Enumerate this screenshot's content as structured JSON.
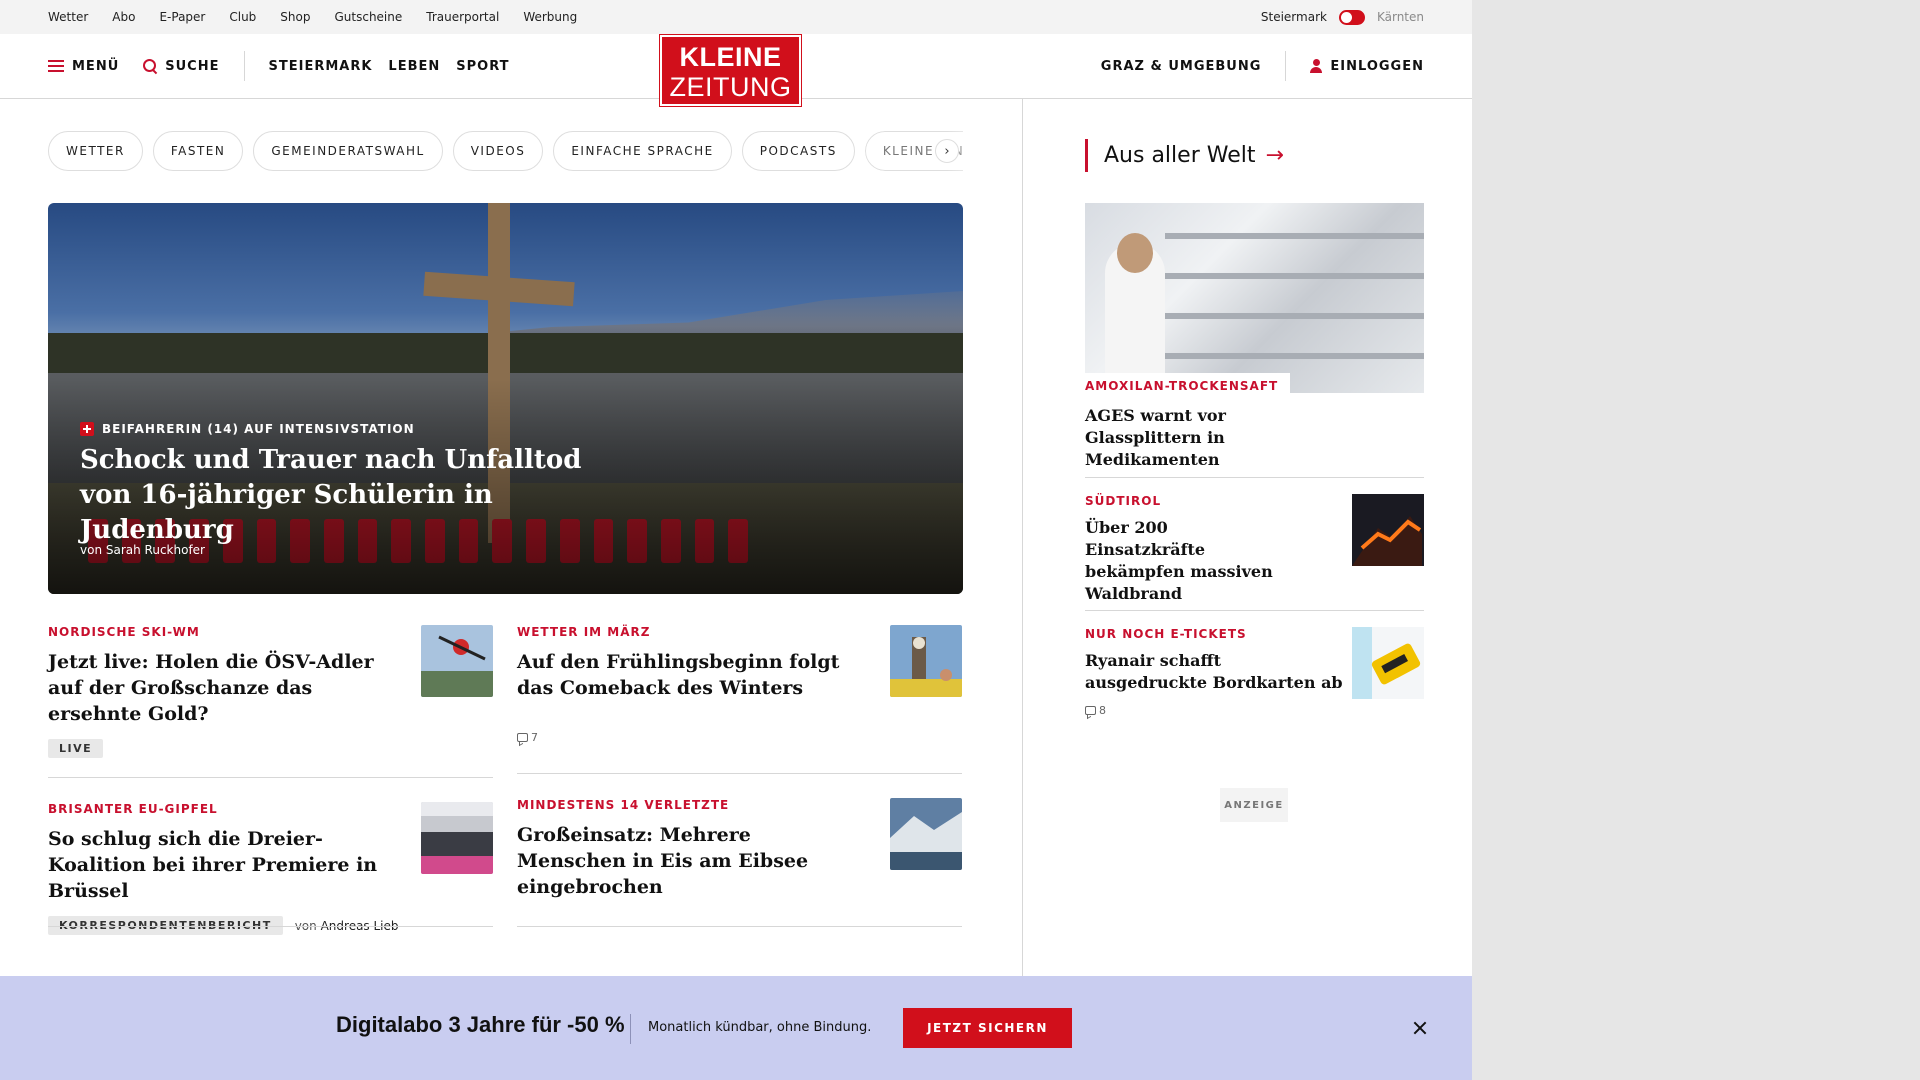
{
  "utility_bar": {
    "links": [
      "Wetter",
      "Abo",
      "E-Paper",
      "Club",
      "Shop",
      "Gutscheine",
      "Trauerportal",
      "Werbung"
    ],
    "region_active": "Steiermark",
    "region_inactive": "Kärnten"
  },
  "header": {
    "menu_label": "MENÜ",
    "search_label": "SUCHE",
    "nav": [
      "STEIERMARK",
      "LEBEN",
      "SPORT"
    ],
    "logo_line1": "KLEINE",
    "logo_line2": "ZEITUNG",
    "region_link": "GRAZ & UMGEBUNG",
    "login_label": "EINLOGGEN"
  },
  "topic_chips": [
    "WETTER",
    "FASTEN",
    "GEMEINDERATSWAHL",
    "VIDEOS",
    "EINFACHE SPRACHE",
    "PODCASTS",
    "KLEINE KINDE"
  ],
  "chips_next_glyph": "›",
  "hero": {
    "kicker": "BEIFAHRERIN (14) AUF INTENSIVSTATION",
    "title": "Schock und Trauer nach Unfalltod von 16-jähriger Schülerin in Judenburg",
    "byline": "von Sarah Ruckhofer"
  },
  "teasers": [
    {
      "kicker": "NORDISCHE SKI-WM",
      "title": "Jetzt live: Holen die ÖSV-Adler auf der Großschanze das ersehnte Gold?",
      "badge": "LIVE"
    },
    {
      "kicker": "WETTER IM MÄRZ",
      "title": "Auf den Frühlingsbeginn folgt das Comeback des Winters",
      "comments": "7"
    },
    {
      "kicker": "BRISANTER EU-GIPFEL",
      "title": "So schlug sich die Dreier-Koalition bei ihrer Premiere in Brüssel",
      "badge": "KORRESPONDENTENBERICHT",
      "byline_prefix": "von",
      "byline_name": "Andreas Lieb"
    },
    {
      "kicker": "MINDESTENS 14 VERLETZTE",
      "title": "Großeinsatz: Mehrere Menschen in Eis am Eibsee eingebrochen"
    }
  ],
  "sidebar": {
    "section_title": "Aus aller Welt",
    "section_arrow": "→",
    "lead": {
      "kicker": "AMOXILAN-TROCKENSAFT",
      "title": "AGES warnt vor Glassplittern in Medikamenten"
    },
    "items": [
      {
        "kicker": "SÜDTIROL",
        "title": "Über 200 Einsatzkräfte bekämpfen massiven Waldbrand"
      },
      {
        "kicker": "NUR NOCH E-TICKETS",
        "title": "Ryanair schafft ausgedruckte Bordkarten ab",
        "comments": "8"
      }
    ],
    "ad_label": "ANZEIGE"
  },
  "promo": {
    "title": "Digitalabo 3 Jahre für -50 %",
    "subtitle": "Monatlich kündbar, ohne Bindung.",
    "button": "JETZT SICHERN"
  },
  "colors": {
    "brand_red": "#d10f1b",
    "promo_background": "#c9cdf0",
    "utility_background": "#f3f3f3"
  }
}
